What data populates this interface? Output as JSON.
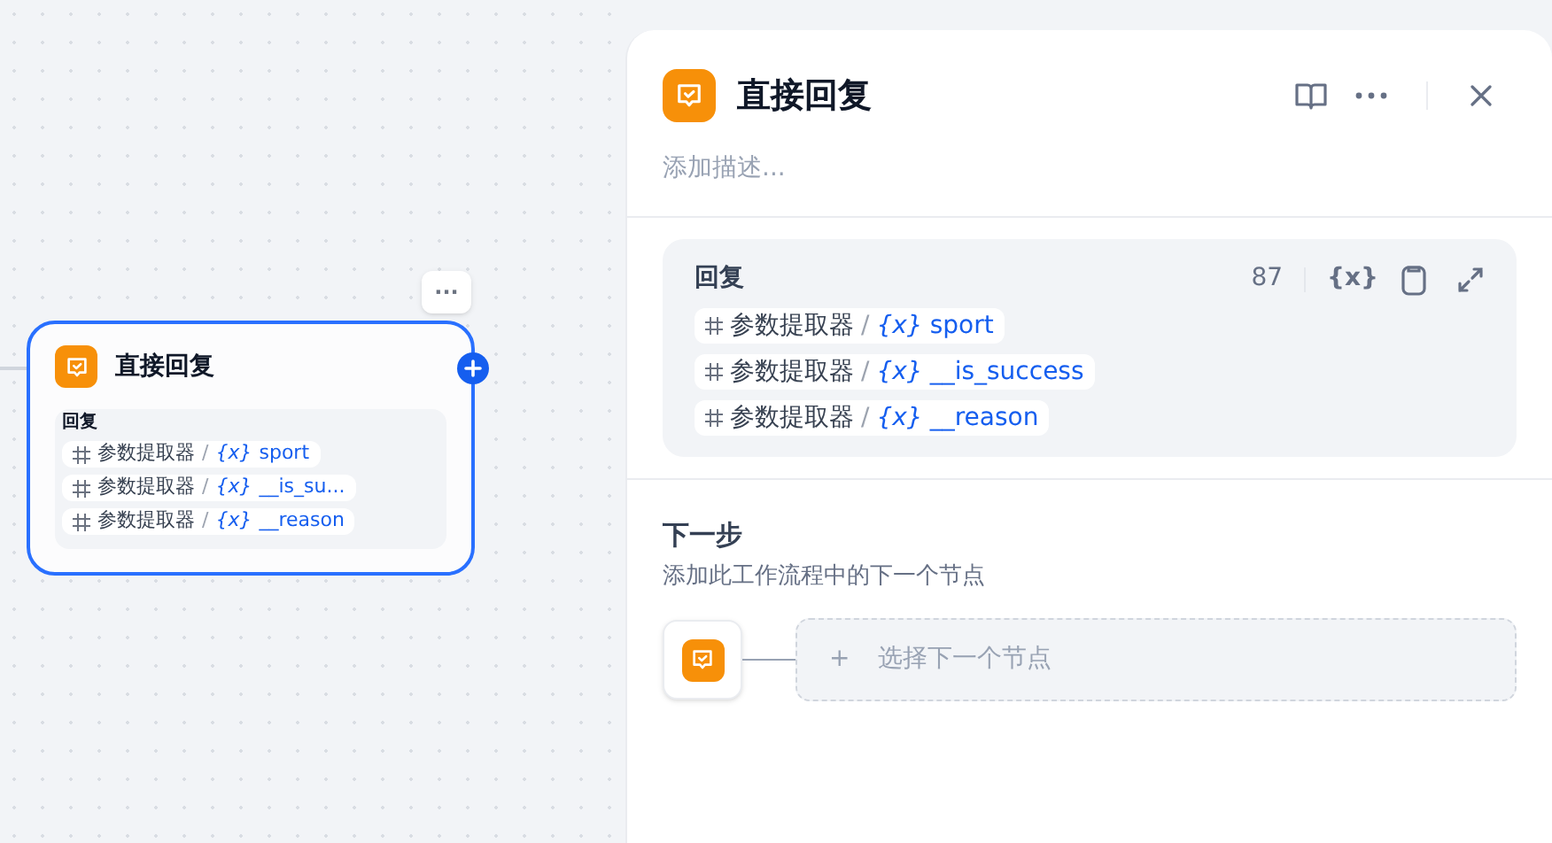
{
  "canvas": {
    "node": {
      "title": "直接回复",
      "field_label": "回复",
      "more": "···",
      "variables": [
        {
          "source": "参数提取器",
          "separator": "/",
          "marker": "{x}",
          "name": "sport"
        },
        {
          "source": "参数提取器",
          "separator": "/",
          "marker": "{x}",
          "name": "__is_su..."
        },
        {
          "source": "参数提取器",
          "separator": "/",
          "marker": "{x}",
          "name": "__reason"
        }
      ]
    }
  },
  "panel": {
    "title": "直接回复",
    "description_placeholder": "添加描述...",
    "reply": {
      "label": "回复",
      "count": "87",
      "marker": "{x}",
      "variables": [
        {
          "source": "参数提取器",
          "separator": "/",
          "marker": "{x}",
          "name": "sport"
        },
        {
          "source": "参数提取器",
          "separator": "/",
          "marker": "{x}",
          "name": "__is_success"
        },
        {
          "source": "参数提取器",
          "separator": "/",
          "marker": "{x}",
          "name": "__reason"
        }
      ]
    },
    "next_step": {
      "title": "下一步",
      "subtitle": "添加此工作流程中的下一个节点",
      "add_symbol": "+",
      "add_label": "选择下一个节点"
    }
  }
}
